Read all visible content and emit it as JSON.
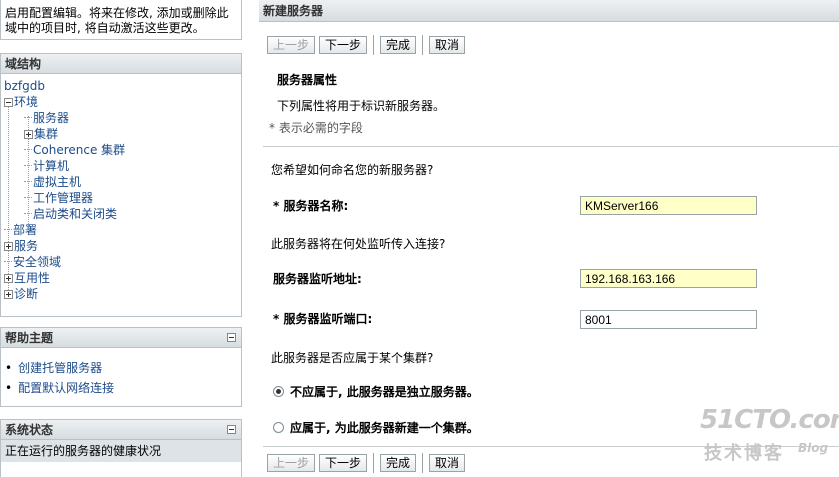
{
  "top_note": {
    "line1": "启用配置编辑。将来在修改, 添加或删除此",
    "line2": "域中的项目时, 将自动激活这些更改。"
  },
  "domain_structure": {
    "title": "域结构",
    "root": "bzfgdb",
    "items": [
      {
        "label": "环境",
        "level": 0,
        "toggle": "minus"
      },
      {
        "label": "服务器",
        "level": 1,
        "toggle": "none"
      },
      {
        "label": "集群",
        "level": 1,
        "toggle": "plus"
      },
      {
        "label": "Coherence 集群",
        "level": 1,
        "toggle": "none"
      },
      {
        "label": "计算机",
        "level": 1,
        "toggle": "none"
      },
      {
        "label": "虚拟主机",
        "level": 1,
        "toggle": "none"
      },
      {
        "label": "工作管理器",
        "level": 1,
        "toggle": "none"
      },
      {
        "label": "启动类和关闭类",
        "level": 1,
        "toggle": "none"
      },
      {
        "label": "部署",
        "level": 0,
        "toggle": "none"
      },
      {
        "label": "服务",
        "level": 0,
        "toggle": "plus"
      },
      {
        "label": "安全领域",
        "level": 0,
        "toggle": "none"
      },
      {
        "label": "互用性",
        "level": 0,
        "toggle": "plus"
      },
      {
        "label": "诊断",
        "level": 0,
        "toggle": "plus"
      }
    ]
  },
  "help_topics": {
    "title": "帮助主题",
    "items": [
      "创建托管服务器",
      "配置默认网络连接"
    ]
  },
  "system_status": {
    "title": "系统状态",
    "row": "正在运行的服务器的健康状况"
  },
  "main": {
    "title": "新建服务器",
    "buttons": {
      "back": "上一步",
      "next": "下一步",
      "finish": "完成",
      "cancel": "取消"
    },
    "section_title": "服务器属性",
    "description": "下列属性将用于标识新服务器。",
    "required_note": "* 表示必需的字段",
    "q_name": "您希望如何命名您的新服务器?",
    "server_name_label": "* 服务器名称:",
    "server_name_value": "KMServer166",
    "q_listen": "此服务器将在何处监听传入连接?",
    "listen_address_label": "服务器监听地址:",
    "listen_address_value": "192.168.163.166",
    "listen_port_label": "* 服务器监听端口:",
    "listen_port_value": "8001",
    "q_cluster": "此服务器是否应属于某个集群?",
    "radio_no": "不应属于, 此服务器是独立服务器。",
    "radio_yes": "应属于, 为此服务器新建一个集群。"
  },
  "watermark": {
    "main": "51CTO.com",
    "sub": "技术博客",
    "blog": "Blog"
  }
}
